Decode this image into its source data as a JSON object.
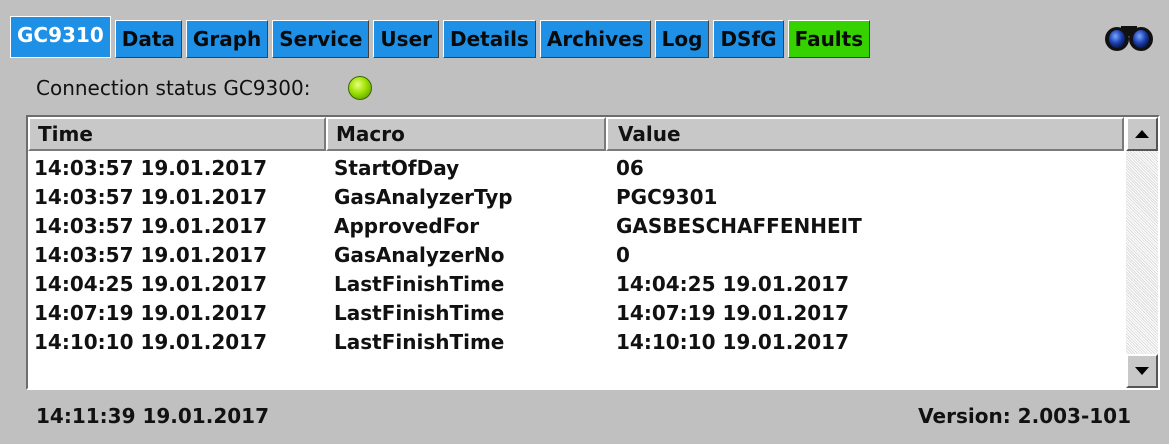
{
  "tabs": [
    {
      "label": "GC9310",
      "active": true
    },
    {
      "label": "Data"
    },
    {
      "label": "Graph"
    },
    {
      "label": "Service"
    },
    {
      "label": "User"
    },
    {
      "label": "Details"
    },
    {
      "label": "Archives"
    },
    {
      "label": "Log"
    },
    {
      "label": "DSfG"
    },
    {
      "label": "Faults"
    }
  ],
  "connection": {
    "label": "Connection status GC9300:",
    "status": "connected",
    "led_color": "#9be000"
  },
  "table": {
    "columns": [
      "Time",
      "Macro",
      "Value"
    ],
    "rows": [
      [
        "14:03:57 19.01.2017",
        "StartOfDay",
        "06"
      ],
      [
        "14:03:57 19.01.2017",
        "GasAnalyzerTyp",
        "PGC9301"
      ],
      [
        "14:03:57 19.01.2017",
        "ApprovedFor",
        "GASBESCHAFFENHEIT"
      ],
      [
        "14:03:57 19.01.2017",
        "GasAnalyzerNo",
        "0"
      ],
      [
        "14:04:25 19.01.2017",
        "LastFinishTime",
        "14:04:25 19.01.2017"
      ],
      [
        "14:07:19 19.01.2017",
        "LastFinishTime",
        "14:07:19 19.01.2017"
      ],
      [
        "14:10:10 19.01.2017",
        "LastFinishTime",
        "14:10:10 19.01.2017"
      ]
    ]
  },
  "status": {
    "time": "14:11:39 19.01.2017",
    "version": "Version: 2.003-101"
  },
  "colors": {
    "tab": "#1e90e6",
    "faults_tab": "#35d200",
    "background": "#c0c0c0"
  },
  "icons": {
    "top_right": "binoculars-icon"
  }
}
